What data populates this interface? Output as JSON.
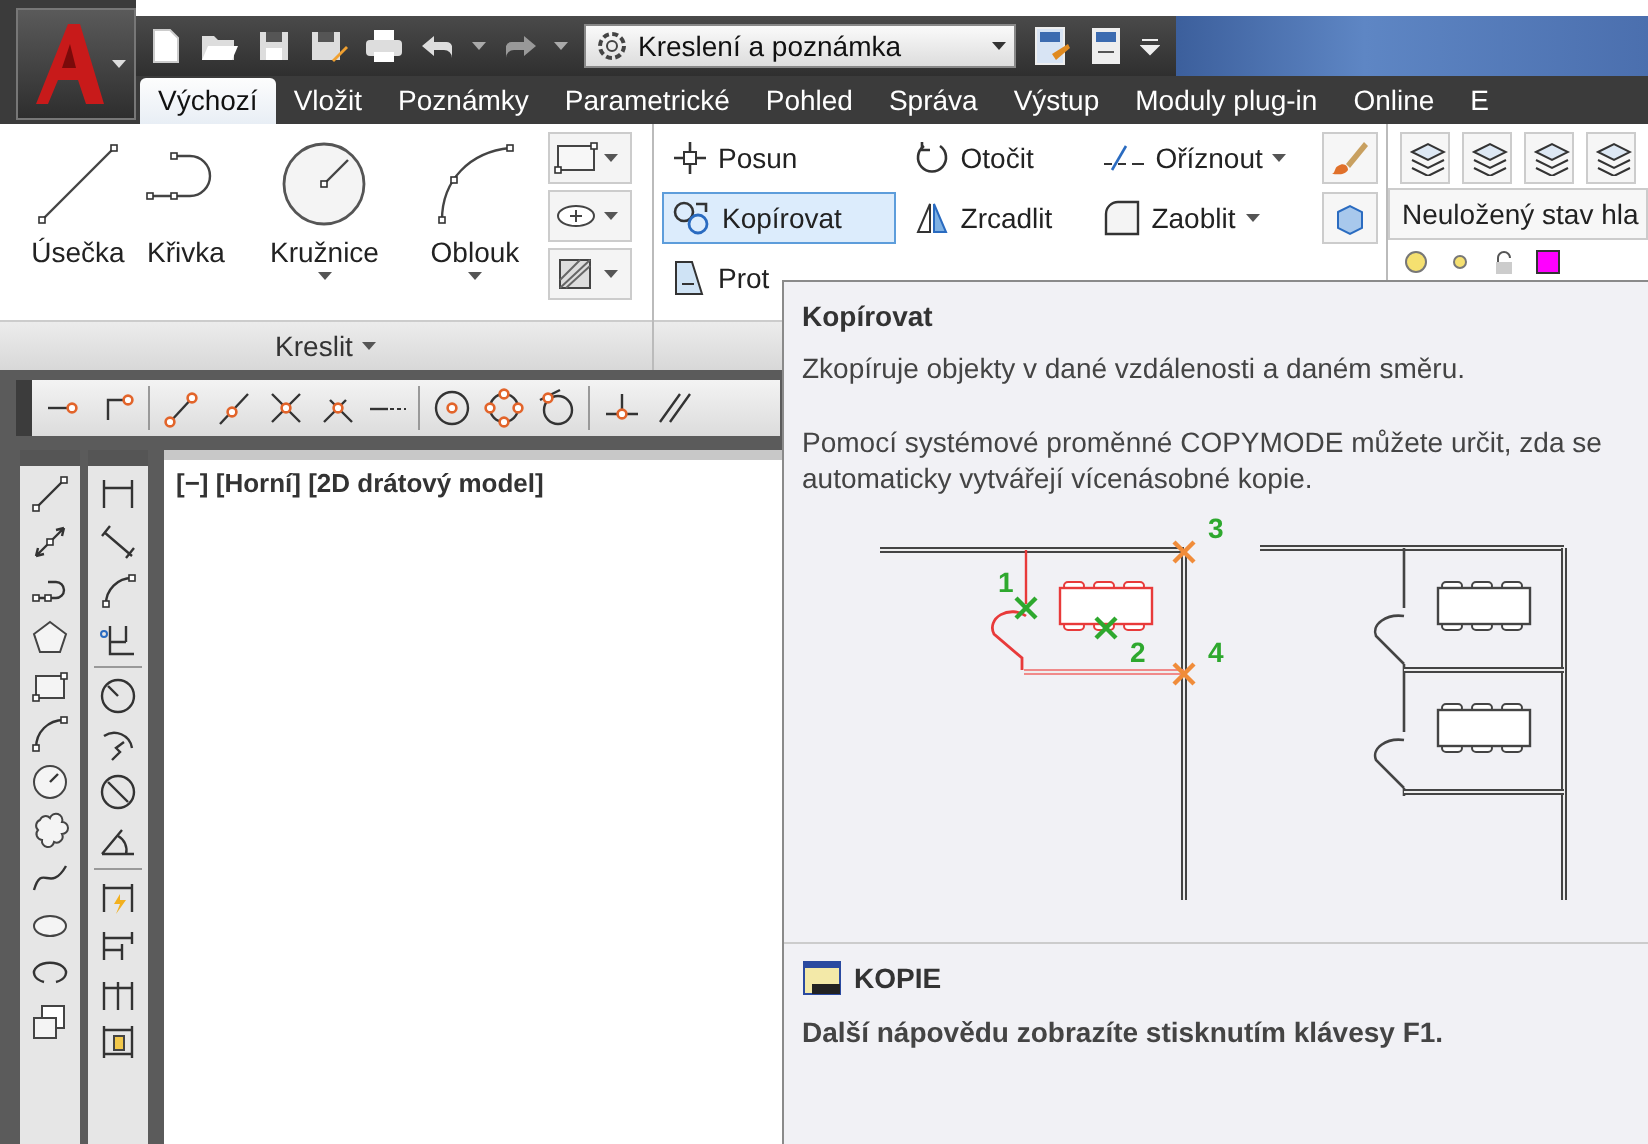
{
  "quick_access": {
    "workspace": "Kreslení a poznámka"
  },
  "tabs": [
    {
      "label": "Výchozí",
      "selected": true
    },
    {
      "label": "Vložit",
      "selected": false
    },
    {
      "label": "Poznámky",
      "selected": false
    },
    {
      "label": "Parametrické",
      "selected": false
    },
    {
      "label": "Pohled",
      "selected": false
    },
    {
      "label": "Správa",
      "selected": false
    },
    {
      "label": "Výstup",
      "selected": false
    },
    {
      "label": "Moduly plug-in",
      "selected": false
    },
    {
      "label": "Online",
      "selected": false
    },
    {
      "label": "E",
      "selected": false
    }
  ],
  "draw_panel": {
    "title": "Kreslit",
    "tools": [
      {
        "label": "Úsečka",
        "dropdown": false
      },
      {
        "label": "Křivka",
        "dropdown": false
      },
      {
        "label": "Kružnice",
        "dropdown": true
      },
      {
        "label": "Oblouk",
        "dropdown": true
      }
    ]
  },
  "modify_panel": {
    "tools": [
      {
        "label": "Posun",
        "selected": false,
        "dropdown": false
      },
      {
        "label": "Kopírovat",
        "selected": true,
        "dropdown": false
      },
      {
        "label": "Prot",
        "selected": false,
        "dropdown": false
      },
      {
        "label": "Otočit",
        "selected": false,
        "dropdown": false
      },
      {
        "label": "Zrcadlit",
        "selected": false,
        "dropdown": false
      },
      {
        "label": "Oříznout",
        "selected": false,
        "dropdown": true
      },
      {
        "label": "Zaoblit",
        "selected": false,
        "dropdown": true
      }
    ]
  },
  "layers_panel": {
    "layer_state": "Neuložený stav hla"
  },
  "viewport": {
    "label": "[−] [Horní] [2D drátový model]"
  },
  "tooltip": {
    "title": "Kopírovat",
    "description": "Zkopíruje objekty v dané vzdálenosti a daném směru.",
    "note": "Pomocí systémové proměnné COPYMODE můžete určit, zda se automaticky vytvářejí vícenásobné kopie.",
    "point_labels": [
      "1",
      "2",
      "3",
      "4"
    ],
    "command": "KOPIE",
    "help": "Další nápovědu zobrazíte stisknutím klávesy F1."
  }
}
